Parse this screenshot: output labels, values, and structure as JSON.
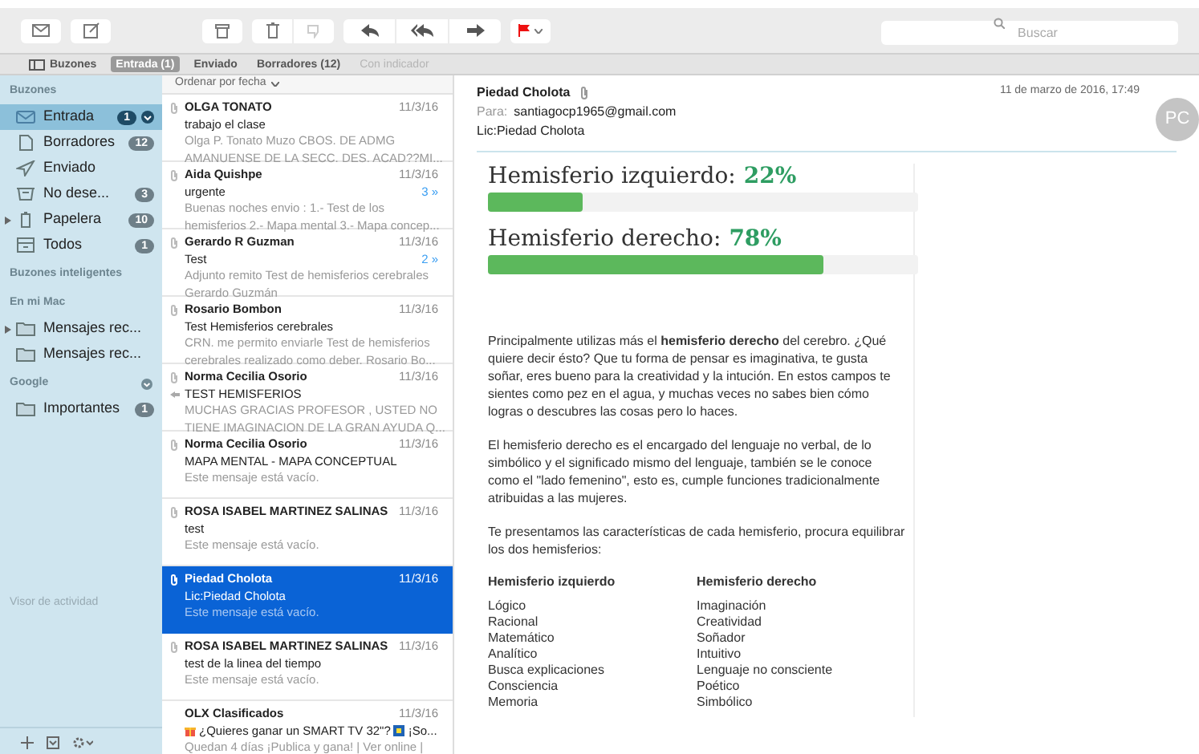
{
  "search": {
    "placeholder": "Buscar"
  },
  "favorites": [
    {
      "label": "Buzones",
      "kind": "toggle",
      "selected": false
    },
    {
      "label": "Entrada (1)",
      "kind": "mailbox",
      "selected": true
    },
    {
      "label": "Enviado",
      "kind": "mailbox",
      "selected": false
    },
    {
      "label": "Borradores (12)",
      "kind": "mailbox",
      "selected": false
    },
    {
      "label": "Con indicador",
      "kind": "mailbox",
      "selected": false,
      "disabled": true
    }
  ],
  "sidebar": {
    "sections": [
      {
        "title": "Buzones",
        "items": [
          {
            "label": "Entrada",
            "kind": "inbox",
            "badge": "1",
            "selected": true,
            "activity": true
          },
          {
            "label": "Borradores",
            "kind": "drafts",
            "badge": "12",
            "selected": false
          },
          {
            "label": "Enviado",
            "kind": "sent",
            "selected": false
          },
          {
            "label": "No dese...",
            "kind": "junk",
            "badge": "3",
            "selected": false
          },
          {
            "label": "Papelera",
            "kind": "trash",
            "badge": "10",
            "selected": false,
            "expandable": true
          },
          {
            "label": "Todos",
            "kind": "all",
            "badge": "1",
            "selected": false
          }
        ]
      },
      {
        "title": "Buzones inteligentes"
      },
      {
        "title": "En mi Mac",
        "items": [
          {
            "label": "Mensajes rec...",
            "kind": "folder",
            "selected": false,
            "expandable": true
          },
          {
            "label": "Mensajes rec...",
            "kind": "folder",
            "selected": false
          }
        ]
      },
      {
        "title": "Google",
        "collapse": true,
        "items": [
          {
            "label": "Importantes",
            "kind": "folder",
            "badge": "1",
            "selected": false
          }
        ]
      }
    ],
    "activity_viewer": "Visor de actividad"
  },
  "sort_label": "Ordenar por fecha",
  "messages": [
    {
      "sender": "OLGA TONATO",
      "date": "11/3/16",
      "subject": "trabajo el clase",
      "preview": [
        "Olga P. Tonato Muzo CBOS. DE ADMG",
        "AMANUENSE DE LA SECC. DES. ACAD??MI..."
      ],
      "attachment": true,
      "selected": false
    },
    {
      "sender": "Aida Quishpe",
      "date": "11/3/16",
      "subject": "urgente",
      "thread": "3 »",
      "preview": [
        "Buenas noches envio : 1.- Test de los",
        "hemisferios 2.- Mapa mental 3.- Mapa concep..."
      ],
      "attachment": true,
      "selected": false
    },
    {
      "sender": "Gerardo R Guzman",
      "date": "11/3/16",
      "subject": "Test",
      "thread": "2 »",
      "preview": [
        "Adjunto remito Test de hemisferios cerebrales",
        "Gerardo Guzmán"
      ],
      "attachment": true,
      "selected": false
    },
    {
      "sender": "Rosario Bombon",
      "date": "11/3/16",
      "subject": "Test Hemisferios cerebrales",
      "preview": [
        "CRN. me permito enviarle Test de hemisferios",
        "cerebrales realizado como deber. Rosario Bo..."
      ],
      "attachment": true,
      "selected": false
    },
    {
      "sender": "Norma Cecilia Osorio",
      "date": "11/3/16",
      "subject": "TEST HEMISFERIOS",
      "preview": [
        "MUCHAS GRACIAS PROFESOR , USTED NO",
        "TIENE IMAGINACION DE LA GRAN AYUDA Q..."
      ],
      "attachment": true,
      "replied": true,
      "selected": false
    },
    {
      "sender": "Norma Cecilia Osorio",
      "date": "11/3/16",
      "subject": "MAPA MENTAL - MAPA CONCEPTUAL",
      "preview": [
        "Este mensaje está vacío."
      ],
      "attachment": true,
      "selected": false
    },
    {
      "sender": "ROSA ISABEL MARTINEZ SALINAS",
      "date": "11/3/16",
      "subject": "test",
      "preview": [
        "Este mensaje está vacío."
      ],
      "attachment": true,
      "selected": false
    },
    {
      "sender": "Piedad Cholota",
      "date": "11/3/16",
      "subject": "Lic:Piedad Cholota",
      "preview": [
        "Este mensaje está vacío."
      ],
      "attachment": true,
      "selected": true
    },
    {
      "sender": "ROSA ISABEL MARTINEZ SALINAS",
      "date": "11/3/16",
      "subject": "test de la linea del tiempo",
      "preview": [
        "Este mensaje está vacío."
      ],
      "attachment": true,
      "selected": false
    },
    {
      "sender": "OLX Clasificados",
      "date": "11/3/16",
      "subject": "¿Quieres ganar un SMART TV 32\"?",
      "subject_tail": "¡So...",
      "gift": true,
      "preview": [
        "Quedan 4 días ¡Publica y gana! | Ver online |"
      ],
      "selected": false
    }
  ],
  "message": {
    "sender": "Piedad Cholota",
    "to_label": "Para:",
    "to": "santiagocp1965@gmail.com",
    "subject": "Lic:Piedad Cholota",
    "date": "11 de marzo de 2016, 17:49",
    "avatar": "PC",
    "results": [
      {
        "title": "Hemisferio izquierdo:",
        "percent": "22%",
        "level": 0.22
      },
      {
        "title": "Hemisferio derecho:",
        "percent": "78%",
        "level": 0.78
      }
    ],
    "paragraphs": [
      "Principalmente utilizas más el **hemisferio derecho** del cerebro. ¿Qué quiere decir ésto? Que tu forma de pensar es imaginativa, te gusta soñar, eres bueno para la creatividad y la intución. En estos campos te sientes como pez en el agua, y muchas veces no sabes bien cómo logras o descubres las cosas pero lo haces.",
      "El hemisferio derecho es el encargado del lenguaje no verbal, de lo simbólico y el significado mismo del lenguaje, también se le conoce como el \"lado femenino\", esto es, cumple funciones tradicionalmente atribuidas a las mujeres.",
      "Te presentamos las características de cada hemisferio, procura equilibrar los dos hemisferios:"
    ],
    "columns": [
      {
        "heading": "Hemisferio izquierdo",
        "items": [
          "Lógico",
          "Racional",
          "Matemático",
          "Analítico",
          "Busca explicaciones",
          "Consciencia",
          "Memoria"
        ]
      },
      {
        "heading": "Hemisferio derecho",
        "items": [
          "Imaginación",
          "Creatividad",
          "Soñador",
          "Intuitivo",
          "Lenguaje no consciente",
          "Poético",
          "Simbólico"
        ]
      }
    ]
  }
}
